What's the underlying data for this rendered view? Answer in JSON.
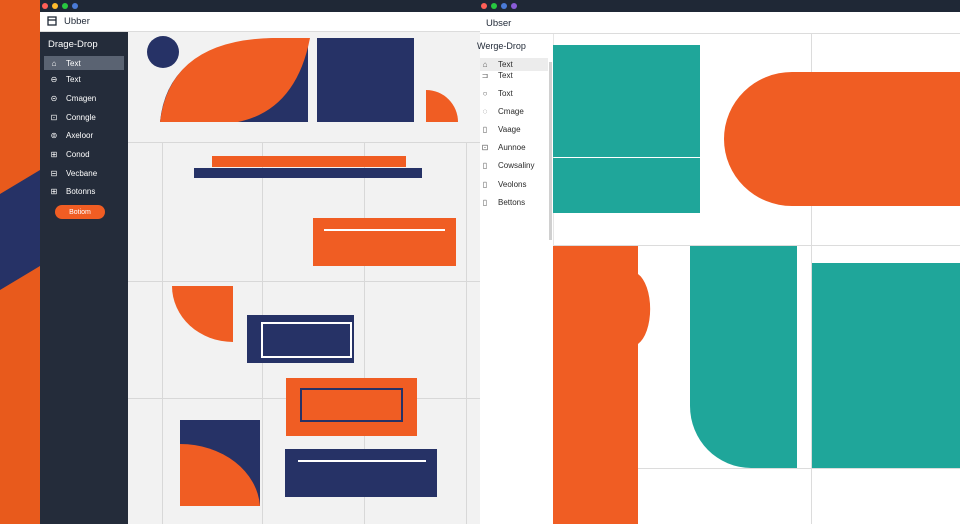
{
  "colors": {
    "orange": "#f05d23",
    "navy": "#263266",
    "teal": "#1fa69a",
    "sidebar_dark": "#242c3a",
    "titlebar": "#1f2836",
    "dot_red": "#ff5f57",
    "dot_yellow": "#febc2e",
    "dot_green": "#28c840",
    "dot_blue": "#4a7bd8",
    "dot_purple": "#8a5cd8"
  },
  "left_window": {
    "app_icon": "app-icon",
    "app_title": "Ubber",
    "sidebar": {
      "title": "Drage-Drop",
      "items": [
        {
          "icon": "⌂",
          "label": "Text"
        },
        {
          "icon": "⊖",
          "label": "Text"
        },
        {
          "icon": "⊝",
          "label": "Cmagen"
        },
        {
          "icon": "⊡",
          "label": "Conngle"
        },
        {
          "icon": "⊚",
          "label": "Axeloor"
        },
        {
          "icon": "⊞",
          "label": "Conod"
        },
        {
          "icon": "⊟",
          "label": "Vecbane"
        },
        {
          "icon": "⊞",
          "label": "Botonns"
        }
      ],
      "button_label": "Botiom"
    }
  },
  "right_window": {
    "app_title": "Ubser",
    "sidebar": {
      "title": "Werge-Drop",
      "items": [
        {
          "icon": "⌂",
          "label": "Text"
        },
        {
          "icon": "⊐",
          "label": "Text"
        },
        {
          "icon": "○",
          "label": "Toxt"
        },
        {
          "icon": "◌",
          "label": "Cmage"
        },
        {
          "icon": "▯",
          "label": "Vaage"
        },
        {
          "icon": "⊡",
          "label": "Aunnoe"
        },
        {
          "icon": "▯",
          "label": "Cowsaliny"
        },
        {
          "icon": "▯",
          "label": "Veolons"
        },
        {
          "icon": "▯",
          "label": "Bettons"
        }
      ]
    }
  }
}
